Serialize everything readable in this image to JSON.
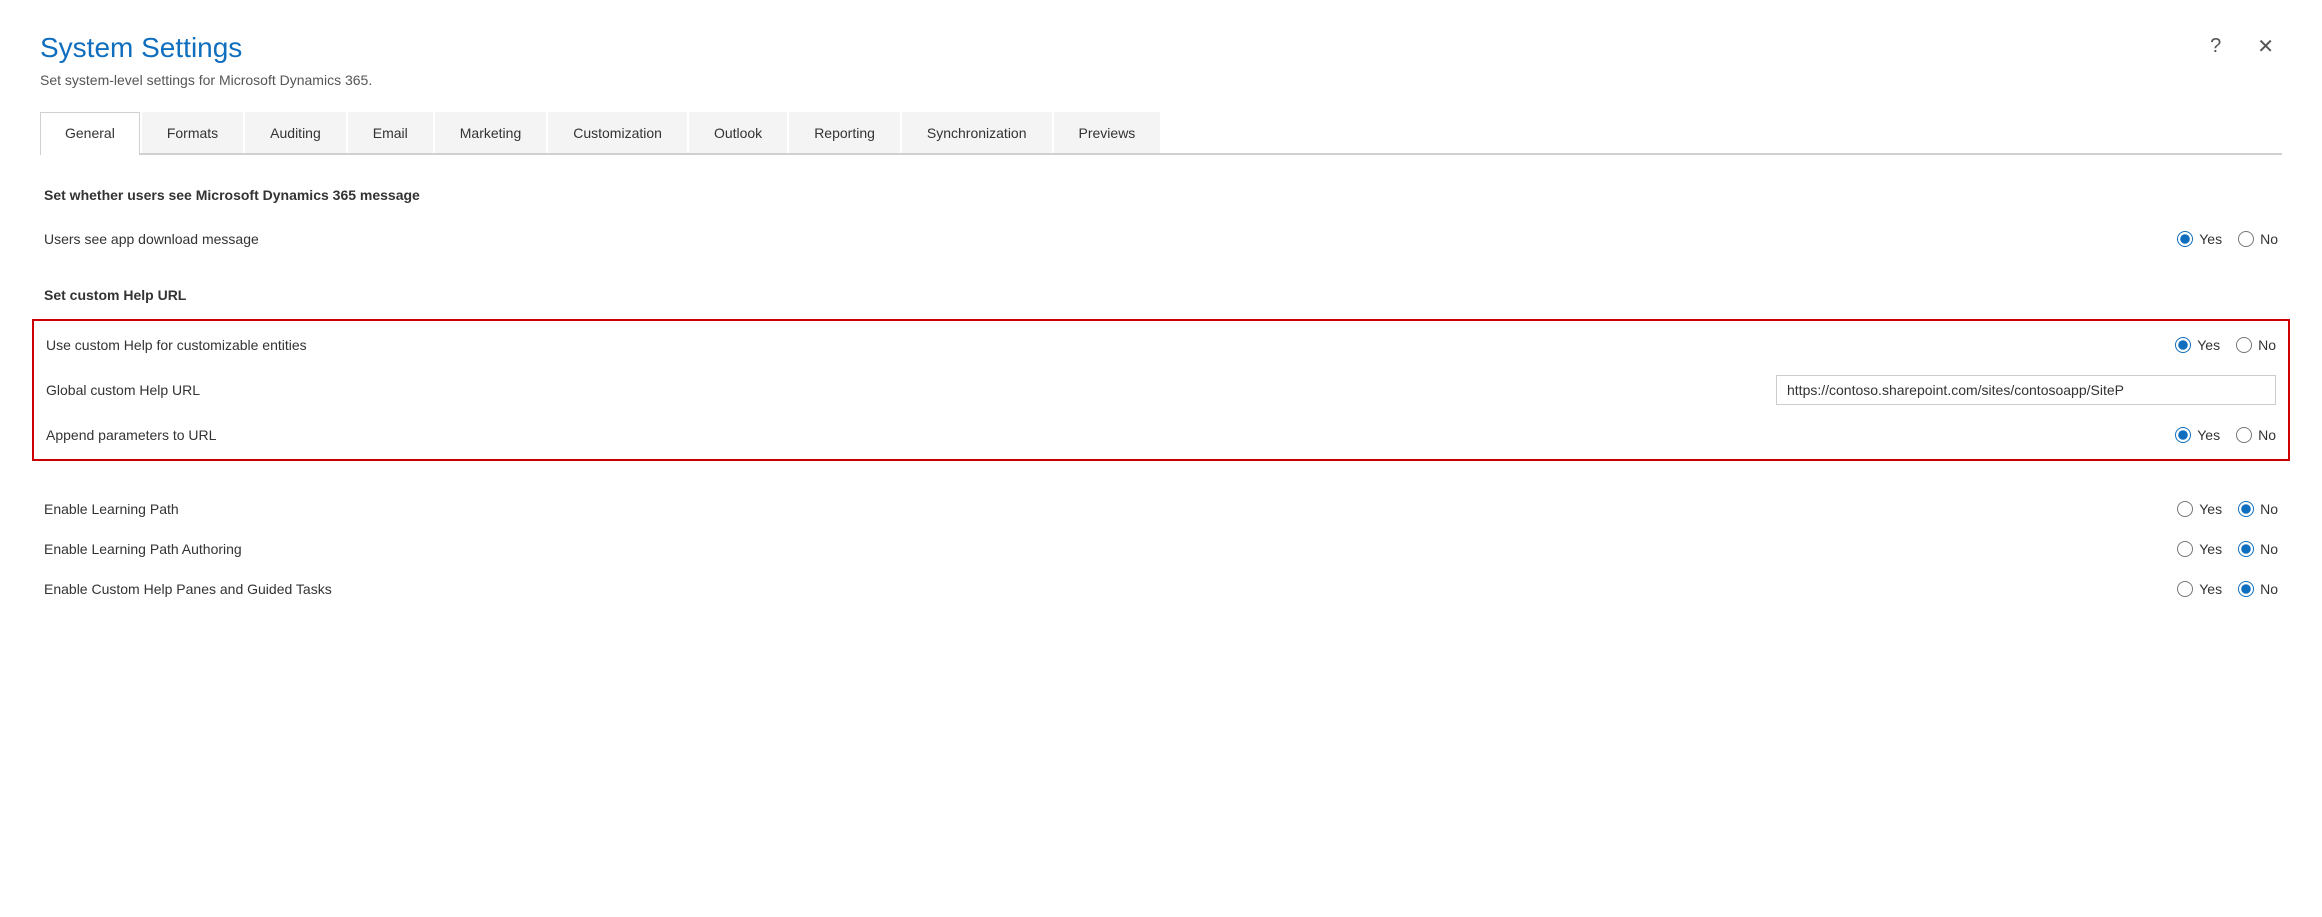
{
  "dialog": {
    "title": "System Settings",
    "subtitle": "Set system-level settings for Microsoft Dynamics 365.",
    "help_button": "?",
    "close_button": "✕"
  },
  "tabs": [
    {
      "id": "general",
      "label": "General",
      "active": true
    },
    {
      "id": "formats",
      "label": "Formats",
      "active": false
    },
    {
      "id": "auditing",
      "label": "Auditing",
      "active": false
    },
    {
      "id": "email",
      "label": "Email",
      "active": false
    },
    {
      "id": "marketing",
      "label": "Marketing",
      "active": false
    },
    {
      "id": "customization",
      "label": "Customization",
      "active": false
    },
    {
      "id": "outlook",
      "label": "Outlook",
      "active": false
    },
    {
      "id": "reporting",
      "label": "Reporting",
      "active": false
    },
    {
      "id": "synchronization",
      "label": "Synchronization",
      "active": false
    },
    {
      "id": "previews",
      "label": "Previews",
      "active": false
    }
  ],
  "sections": {
    "dynamics_message": {
      "title": "Set whether users see Microsoft Dynamics 365 message",
      "settings": [
        {
          "id": "app_download_message",
          "label": "Users see app download message",
          "type": "radio",
          "selected": "yes"
        }
      ]
    },
    "custom_help_url": {
      "title": "Set custom Help URL",
      "settings": [
        {
          "id": "custom_help_entities",
          "label": "Use custom Help for customizable entities",
          "type": "radio",
          "selected": "yes",
          "highlighted": true
        },
        {
          "id": "global_custom_help_url",
          "label": "Global custom Help URL",
          "type": "text",
          "value": "https://contoso.sharepoint.com/sites/contosoapp/SiteP",
          "highlighted": true
        },
        {
          "id": "append_params",
          "label": "Append parameters to URL",
          "type": "radio",
          "selected": "yes",
          "highlighted": true
        }
      ]
    },
    "learning": {
      "settings": [
        {
          "id": "enable_learning_path",
          "label": "Enable Learning Path",
          "type": "radio",
          "selected": "no"
        },
        {
          "id": "enable_learning_path_authoring",
          "label": "Enable Learning Path Authoring",
          "type": "radio",
          "selected": "no"
        },
        {
          "id": "enable_custom_help_panes",
          "label": "Enable Custom Help Panes and Guided Tasks",
          "type": "radio",
          "selected": "no"
        }
      ]
    }
  },
  "radio": {
    "yes_label": "Yes",
    "no_label": "No"
  }
}
